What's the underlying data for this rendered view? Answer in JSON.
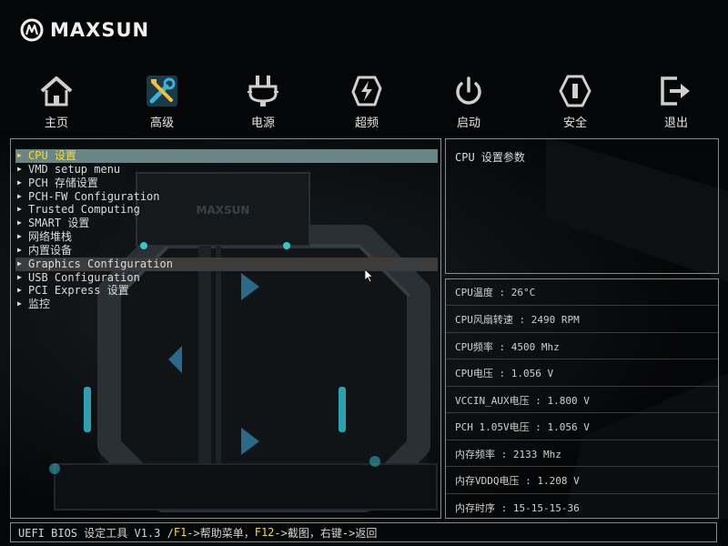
{
  "brand": {
    "name": "MAXSUN"
  },
  "nav": [
    {
      "label": "主页",
      "icon": "home-icon"
    },
    {
      "label": "高级",
      "icon": "tools-icon",
      "active": true
    },
    {
      "label": "电源",
      "icon": "power-plug-icon"
    },
    {
      "label": "超频",
      "icon": "lightning-icon"
    },
    {
      "label": "启动",
      "icon": "power-button-icon"
    },
    {
      "label": "安全",
      "icon": "shield-icon"
    },
    {
      "label": "退出",
      "icon": "exit-icon"
    }
  ],
  "menu": {
    "items": [
      {
        "label": "CPU 设置",
        "selected": true
      },
      {
        "label": "VMD setup menu"
      },
      {
        "label": "PCH 存储设置"
      },
      {
        "label": "PCH-FW Configuration"
      },
      {
        "label": "Trusted Computing"
      },
      {
        "label": "SMART 设置"
      },
      {
        "label": "网络堆栈"
      },
      {
        "label": "内置设备"
      },
      {
        "label": "Graphics Configuration",
        "highlighted": true
      },
      {
        "label": "USB Configuration"
      },
      {
        "label": "PCI Express 设置"
      },
      {
        "label": "监控"
      }
    ]
  },
  "help": {
    "text": "CPU 设置参数"
  },
  "status": [
    "CPU温度 : 26°C",
    "CPU风扇转速 : 2490 RPM",
    "CPU频率 : 4500 Mhz",
    "CPU电压 : 1.056 V",
    "VCCIN_AUX电压 : 1.800 V",
    "PCH 1.05V电压 : 1.056 V",
    "内存频率 : 2133 Mhz",
    "内存VDDQ电压 : 1.208 V",
    "内存时序 : 15-15-15-36"
  ],
  "footer": {
    "prefix": "UEFI BIOS 设定工具 V1.3 / ",
    "key1": "F1",
    "text1": "->帮助菜单，",
    "key2": "F12",
    "text2": "->截图，右键->返回"
  },
  "art": {
    "label": "MAXSUN"
  },
  "colors": {
    "selected_bg": "#6a8585",
    "selected_fg": "#f5dc3e",
    "highlight_bg": "#3c3c3c",
    "accent_cyan": "#35c6d6",
    "panel_border": "#8a8a8a"
  }
}
